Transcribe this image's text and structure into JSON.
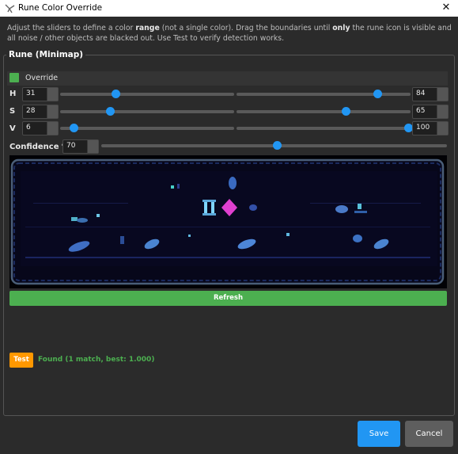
{
  "window": {
    "title": "Rune Color Override",
    "close_label": "✕"
  },
  "description": {
    "part1": "Adjust the sliders to define a color ",
    "bold1": "range",
    "part2": " (not a single color). Drag the boundaries until ",
    "bold2": "only",
    "part3": " the rune icon is visible and all noise / other objects are blacked out. Use Test to verify detection works."
  },
  "group": {
    "title": "Rune (Minimap)"
  },
  "override": {
    "label": "Override",
    "checked": true,
    "color": "#4caf50"
  },
  "ranges": [
    {
      "label": "H",
      "min_value": "31",
      "max_value": "84",
      "min_fraction": 0.32,
      "max_fraction": 0.81
    },
    {
      "label": "S",
      "min_value": "28",
      "max_value": "65",
      "min_fraction": 0.29,
      "max_fraction": 0.63
    },
    {
      "label": "V",
      "min_value": "6",
      "max_value": "100",
      "min_fraction": 0.08,
      "max_fraction": 0.99
    }
  ],
  "confidence": {
    "label": "Confidence %",
    "value": "70",
    "fraction": 0.51
  },
  "buttons": {
    "refresh": "Refresh",
    "test": "Test",
    "save": "Save",
    "cancel": "Cancel"
  },
  "status": {
    "text": "Found (1 match, best: 1.000)",
    "color": "#4caf50"
  },
  "colors": {
    "accent": "#2196f3",
    "success": "#4caf50",
    "warning": "#ff9800",
    "rune": "#e040d0"
  }
}
